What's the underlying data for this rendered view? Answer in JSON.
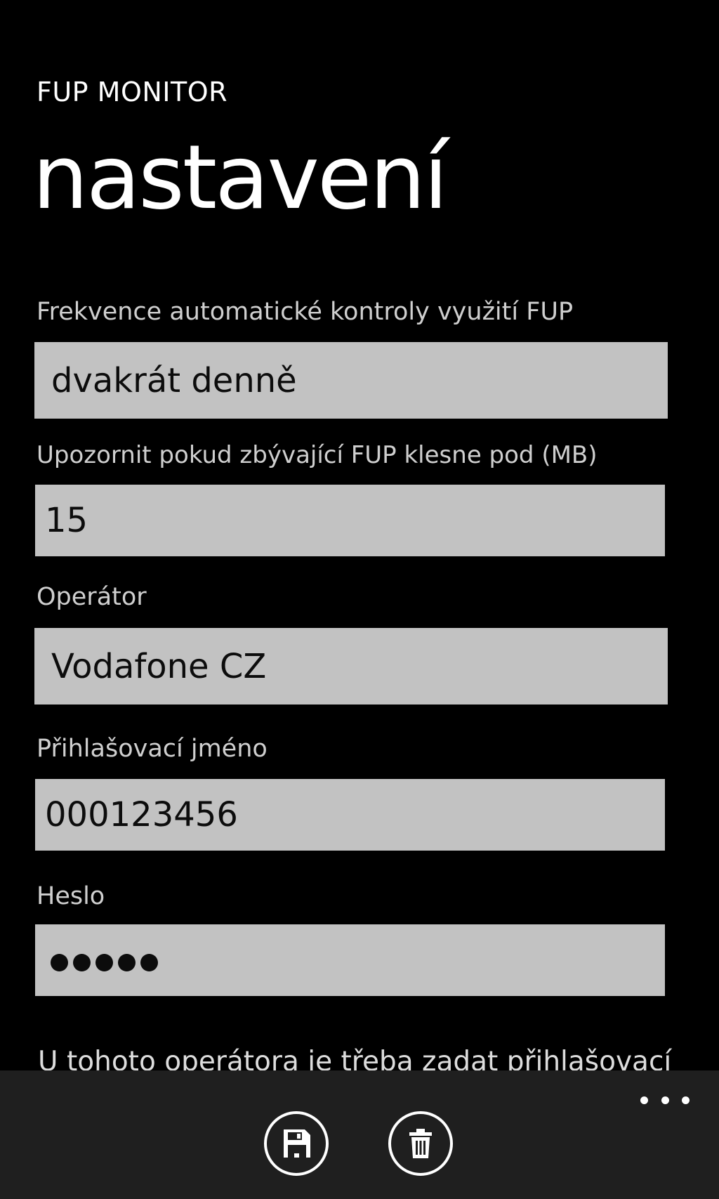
{
  "header": {
    "app_name": "FUP MONITOR",
    "page_title": "nastavení"
  },
  "settings": {
    "frequency": {
      "label": "Frekvence automatické kontroly využití FUP",
      "value": "dvakrát denně"
    },
    "threshold": {
      "label": "Upozornit pokud zbývající FUP klesne pod (MB)",
      "value": "15"
    },
    "operator": {
      "label": "Operátor",
      "value": "Vodafone CZ"
    },
    "login": {
      "label": "Přihlašovací jméno",
      "value": "000123456"
    },
    "password": {
      "label": "Heslo",
      "masked_length": 5
    },
    "note": "U tohoto operátora je třeba zadat přihlašovací"
  },
  "app_bar": {
    "buttons": [
      {
        "icon": "save-icon"
      },
      {
        "icon": "trash-icon"
      }
    ],
    "more_icon": "more-icon"
  },
  "colors": {
    "background": "#000000",
    "field": "#c2c2c2",
    "app_bar": "#1f1f1f"
  }
}
